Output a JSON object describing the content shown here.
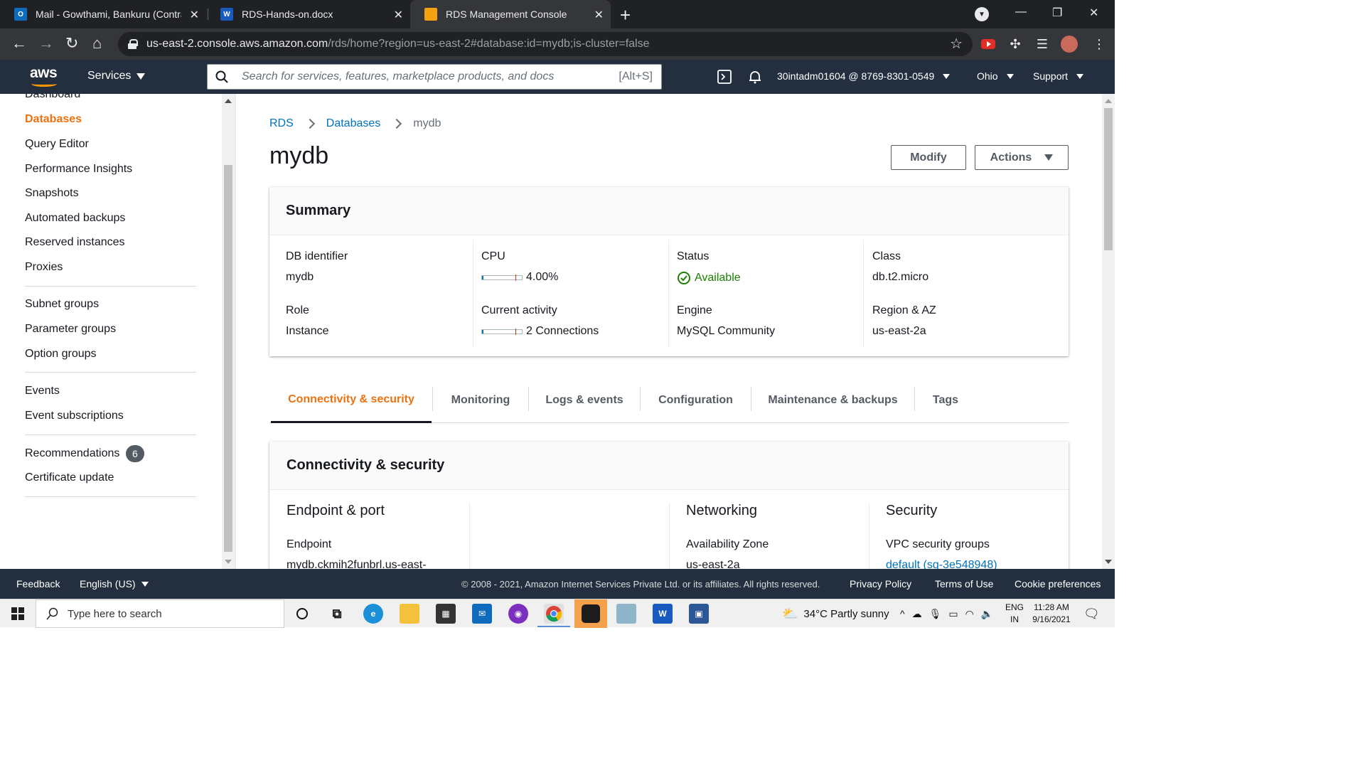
{
  "browser": {
    "tabs": [
      {
        "title": "Mail - Gowthami, Bankuru (Contra",
        "favicon": "outlook-icon"
      },
      {
        "title": "RDS-Hands-on.docx",
        "favicon": "word-icon"
      },
      {
        "title": "RDS Management Console",
        "favicon": "aws-box-icon",
        "active": true
      }
    ],
    "url_host": "us-east-2.console.aws.amazon.com",
    "url_path": "/rds/home?region=us-east-2#database:id=mydb;is-cluster=false"
  },
  "aws_header": {
    "logo": "aws",
    "services_label": "Services",
    "search_placeholder": "Search for services, features, marketplace products, and docs",
    "search_shortcut": "[Alt+S]",
    "account": "30intadm01604 @ 8769-8301-0549",
    "region": "Ohio",
    "support": "Support"
  },
  "sidebar": {
    "items": [
      {
        "label": "Dashboard"
      },
      {
        "label": "Databases",
        "active": true
      },
      {
        "label": "Query Editor"
      },
      {
        "label": "Performance Insights"
      },
      {
        "label": "Snapshots"
      },
      {
        "label": "Automated backups"
      },
      {
        "label": "Reserved instances"
      },
      {
        "label": "Proxies"
      },
      {
        "label": "Subnet groups"
      },
      {
        "label": "Parameter groups"
      },
      {
        "label": "Option groups"
      },
      {
        "label": "Events"
      },
      {
        "label": "Event subscriptions"
      },
      {
        "label": "Recommendations",
        "badge": "6"
      },
      {
        "label": "Certificate update"
      }
    ]
  },
  "main": {
    "breadcrumb": [
      "RDS",
      "Databases",
      "mydb"
    ],
    "title": "mydb",
    "modify_label": "Modify",
    "actions_label": "Actions",
    "summary": {
      "title": "Summary",
      "db_identifier_label": "DB identifier",
      "db_identifier": "mydb",
      "role_label": "Role",
      "role": "Instance",
      "cpu_label": "CPU",
      "cpu": "4.00%",
      "cpu_fraction": 0.04,
      "activity_label": "Current activity",
      "activity": "2 Connections",
      "activity_fraction": 0.03,
      "status_label": "Status",
      "status": "Available",
      "engine_label": "Engine",
      "engine": "MySQL Community",
      "class_label": "Class",
      "class": "db.t2.micro",
      "region_label": "Region & AZ",
      "region": "us-east-2a"
    },
    "tabs": [
      "Connectivity & security",
      "Monitoring",
      "Logs & events",
      "Configuration",
      "Maintenance & backups",
      "Tags"
    ],
    "connectivity": {
      "title": "Connectivity & security",
      "endpoint_port_title": "Endpoint & port",
      "endpoint_label": "Endpoint",
      "endpoint_value": "mydb.ckmih2funbrl.us-east-",
      "networking_title": "Networking",
      "az_label": "Availability Zone",
      "az_value": "us-east-2a",
      "security_title": "Security",
      "vpc_sg_label": "VPC security groups",
      "vpc_sg_value": "default (sg-3e548948)"
    }
  },
  "footer": {
    "feedback": "Feedback",
    "language": "English (US)",
    "copyright": "© 2008 - 2021, Amazon Internet Services Private Ltd. or its affiliates. All rights reserved.",
    "privacy": "Privacy Policy",
    "terms": "Terms of Use",
    "cookies": "Cookie preferences"
  },
  "taskbar": {
    "search_placeholder": "Type here to search",
    "weather": "34°C  Partly sunny",
    "lang_1": "ENG",
    "lang_2": "IN",
    "time": "11:28 AM",
    "date": "9/16/2021"
  },
  "colors": {
    "aws_header": "#232f3e",
    "accent_orange": "#ec7211",
    "link_blue": "#0073bb",
    "success_green": "#1d8102"
  }
}
